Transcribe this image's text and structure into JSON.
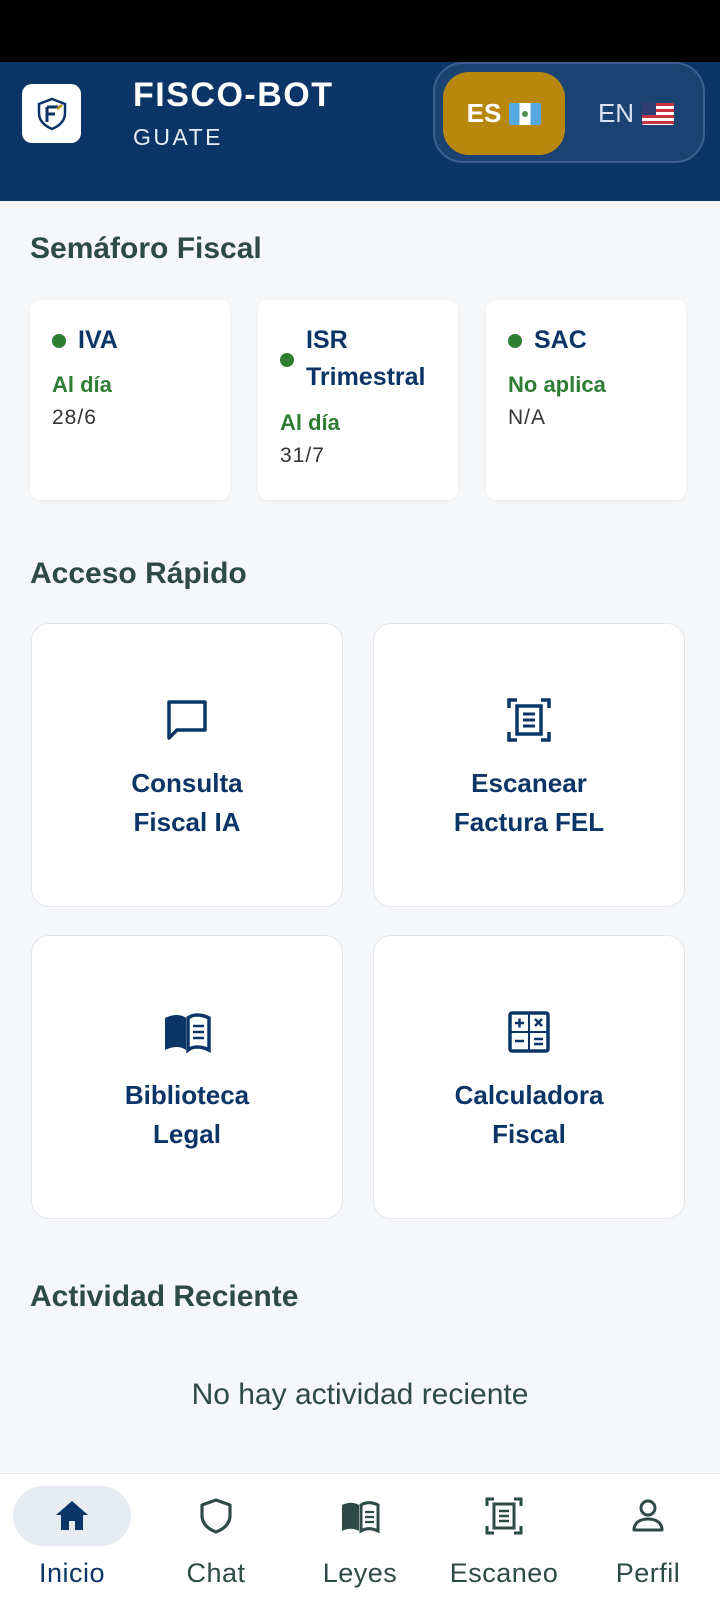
{
  "header": {
    "title": "FISCO-BOT",
    "subtitle": "GUATE",
    "logo_icon": "fisco-logo-icon",
    "language": {
      "es_label": "ES",
      "en_label": "EN",
      "selected": "ES",
      "es_flag": "guatemala-flag-icon",
      "en_flag": "usa-flag-icon"
    }
  },
  "semaforo": {
    "title": "Semáforo Fiscal",
    "cards": [
      {
        "name": "IVA",
        "status": "Al día",
        "date": "28/6",
        "color": "#2e7d32"
      },
      {
        "name_line1": "ISR",
        "name_line2": "Trimestral",
        "status": "Al día",
        "date": "31/7",
        "color": "#2e7d32"
      },
      {
        "name": "SAC",
        "status": "No aplica",
        "date": "N/A",
        "color": "#2e7d32"
      }
    ]
  },
  "quick_access": {
    "title": "Acceso Rápido",
    "items": [
      {
        "line1": "Consulta",
        "line2": "Fiscal IA",
        "icon": "chat-bubble-icon"
      },
      {
        "line1": "Escanear",
        "line2": "Factura FEL",
        "icon": "document-scanner-icon"
      },
      {
        "line1": "Biblioteca",
        "line2": "Legal",
        "icon": "book-icon"
      },
      {
        "line1": "Calculadora",
        "line2": "Fiscal",
        "icon": "calculator-icon"
      }
    ]
  },
  "recent_activity": {
    "title": "Actividad Reciente",
    "empty_text": "No hay actividad reciente"
  },
  "bottom_nav": {
    "active": "Inicio",
    "items": [
      {
        "label": "Inicio",
        "icon": "home-icon"
      },
      {
        "label": "Chat",
        "icon": "shield-icon"
      },
      {
        "label": "Leyes",
        "icon": "book-icon"
      },
      {
        "label": "Escaneo",
        "icon": "document-scanner-icon"
      },
      {
        "label": "Perfil",
        "icon": "person-icon"
      }
    ]
  },
  "colors": {
    "primary": "#0b3566",
    "accent": "#b8870e",
    "ok_green": "#2e7d32",
    "background": "#f5f7f9"
  }
}
